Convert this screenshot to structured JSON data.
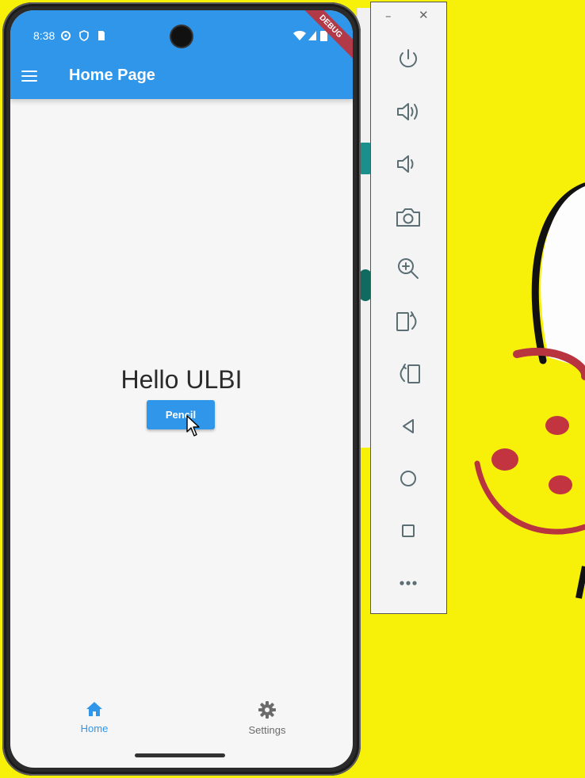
{
  "status_bar": {
    "time": "8:38",
    "debug_banner": "DEBUG"
  },
  "app_bar": {
    "title": "Home Page",
    "menu_icon": "hamburger-menu-icon",
    "color": "#2f96ea"
  },
  "body": {
    "greeting": "Hello ULBI",
    "button_label": "Pencil"
  },
  "bottom_nav": {
    "items": [
      {
        "label": "Home",
        "icon": "home-icon",
        "selected": true
      },
      {
        "label": "Settings",
        "icon": "gear-icon",
        "selected": false
      }
    ]
  },
  "emulator_toolbar": {
    "window_controls": [
      "–",
      "✕"
    ],
    "buttons": [
      "power-icon",
      "volume-up-icon",
      "volume-down-icon",
      "camera-icon",
      "zoom-icon",
      "rotate-left-icon",
      "rotate-right-icon",
      "back-icon",
      "home-circle-icon",
      "overview-icon",
      "more-icon"
    ]
  },
  "colors": {
    "accent": "#2f96ea",
    "background": "#f7f10a",
    "inactive": "#6b6b6b"
  }
}
